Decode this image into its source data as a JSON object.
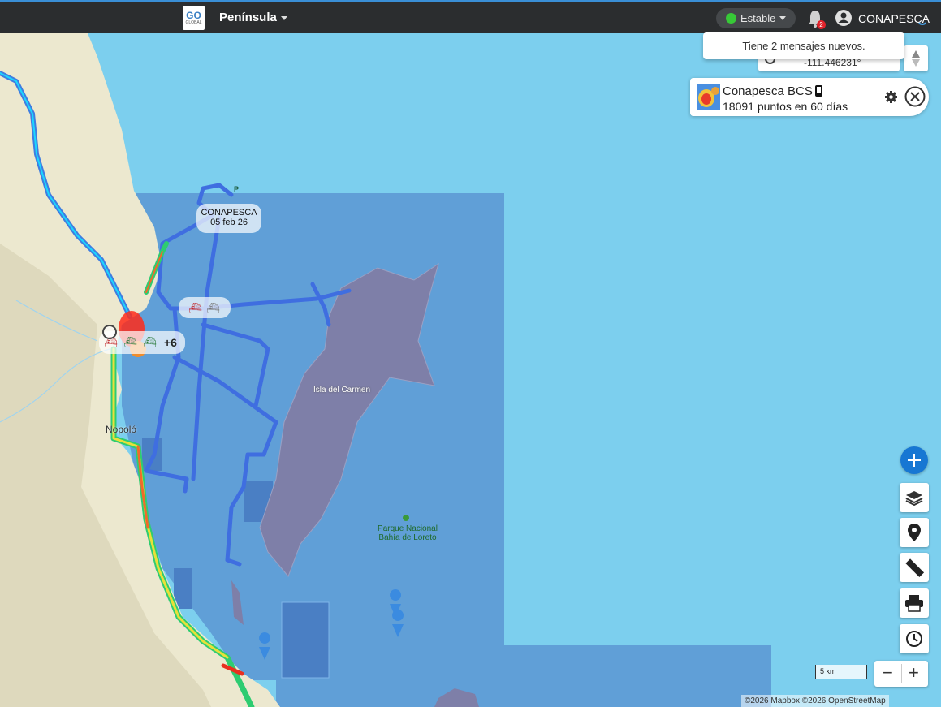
{
  "header": {
    "logo_text": "GO",
    "logo_sub": "GLOBAL",
    "region": "Península",
    "status": "Estable",
    "notification_count": "2",
    "username": "CONAPESCA"
  },
  "toast": {
    "message": "Tiene 2 mensajes nuevos."
  },
  "coords": {
    "longitude": "-111.446231°"
  },
  "layer_card": {
    "title": "Conapesca BCS",
    "subtitle": "18091 puntos en 60 días"
  },
  "map": {
    "vessel_label": {
      "name": "CONAPESCA",
      "date": "05 feb 26"
    },
    "cluster_count": "+6",
    "place_island": "Isla del Carmen",
    "place_town": "Nopoló",
    "park": "Parque Nacional Bahía de Loreto",
    "marker_letter": "P",
    "scale": "5 km",
    "attribution": "©2026 Mapbox ©2026 OpenStreetMap"
  },
  "colors": {
    "accent": "#1777d3",
    "status_green": "#37c837",
    "sea": "#7ccfee",
    "zone": "#5f9cd5",
    "island": "#7e7fa8",
    "land": "#ece8cf"
  },
  "controls": [
    "plus-icon",
    "layers-icon",
    "location-pin-icon",
    "ruler-icon",
    "printer-icon",
    "history-icon"
  ]
}
